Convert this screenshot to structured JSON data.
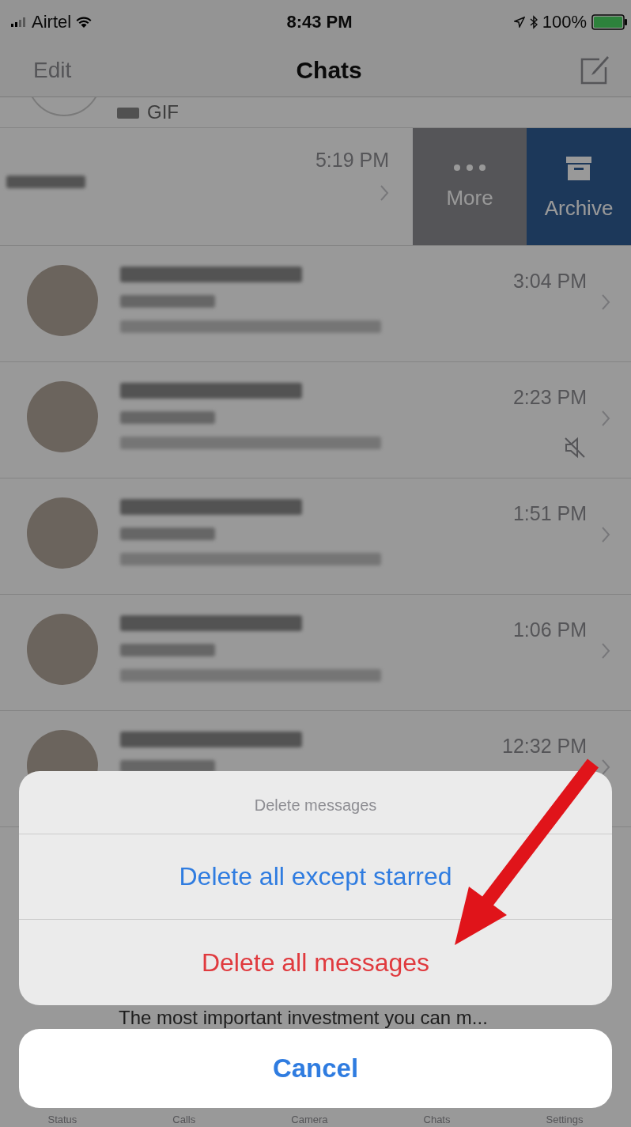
{
  "status_bar": {
    "carrier": "Airtel",
    "time": "8:43 PM",
    "battery": "100%"
  },
  "nav": {
    "left": "Edit",
    "title": "Chats"
  },
  "partial_row": {
    "preview": "GIF"
  },
  "swiped_row": {
    "time": "5:19 PM",
    "actions": [
      {
        "label": "More",
        "kind": "more"
      },
      {
        "label": "Archive",
        "kind": "archive"
      }
    ]
  },
  "chats": [
    {
      "time": "3:04 PM",
      "muted": false
    },
    {
      "time": "2:23 PM",
      "muted": true
    },
    {
      "time": "1:51 PM",
      "muted": false
    },
    {
      "time": "1:06 PM",
      "muted": false
    },
    {
      "time": "12:32 PM",
      "muted": false
    }
  ],
  "last_row": {
    "preview": "The most important investment you can m..."
  },
  "tab_bar": [
    "Status",
    "Calls",
    "Camera",
    "Chats",
    "Settings"
  ],
  "action_sheet": {
    "title": "Delete messages",
    "options": [
      {
        "label": "Delete all except starred",
        "kind": "default"
      },
      {
        "label": "Delete all messages",
        "kind": "destructive"
      }
    ],
    "cancel": "Cancel"
  }
}
